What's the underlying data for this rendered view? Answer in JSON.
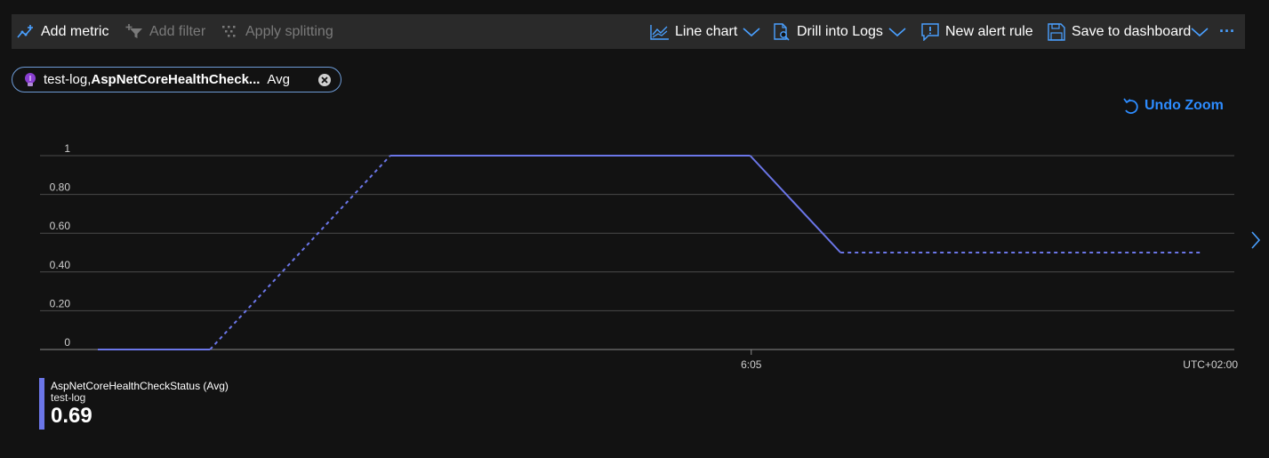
{
  "toolbar": {
    "add_metric": "Add metric",
    "add_filter": "Add filter",
    "apply_splitting": "Apply splitting",
    "line_chart": "Line chart",
    "drill_into_logs": "Drill into Logs",
    "new_alert_rule": "New alert rule",
    "save_to_dashboard": "Save to dashboard",
    "more": "···",
    "add_filter_disabled": true,
    "apply_splitting_disabled": true
  },
  "metric_pill": {
    "resource": "test-log,",
    "metric": "AspNetCoreHealthCheck...",
    "aggregation": "Avg",
    "icon": "lightbulb-icon"
  },
  "undo_zoom": "Undo Zoom",
  "chart_data": {
    "type": "line",
    "yticks": [
      "1",
      "0.80",
      "0.60",
      "0.40",
      "0.20",
      "0"
    ],
    "ylim": [
      0,
      1
    ],
    "xticks": [
      "6:05"
    ],
    "timezone": "UTC+02:00",
    "grid": true,
    "series": [
      {
        "name": "AspNetCoreHealthCheckStatus (Avg)",
        "color": "#6b76e8",
        "points": [
          {
            "t": 0.0,
            "v": 0,
            "seg": "solid"
          },
          {
            "t": 0.206,
            "v": 0,
            "seg": "dashed"
          },
          {
            "t": 0.537,
            "v": 1,
            "seg": "solid"
          },
          {
            "t": 1.198,
            "v": 1,
            "seg": "solid"
          },
          {
            "t": 1.364,
            "v": 0.5,
            "seg": "dashed"
          },
          {
            "t": 2.03,
            "v": 0.5,
            "seg": "end"
          }
        ],
        "x_tick_positions_t": [
          1.2
        ]
      }
    ]
  },
  "legend": {
    "metric": "AspNetCoreHealthCheckStatus (Avg)",
    "resource": "test-log",
    "value": "0.69",
    "color": "#6b76e8"
  }
}
